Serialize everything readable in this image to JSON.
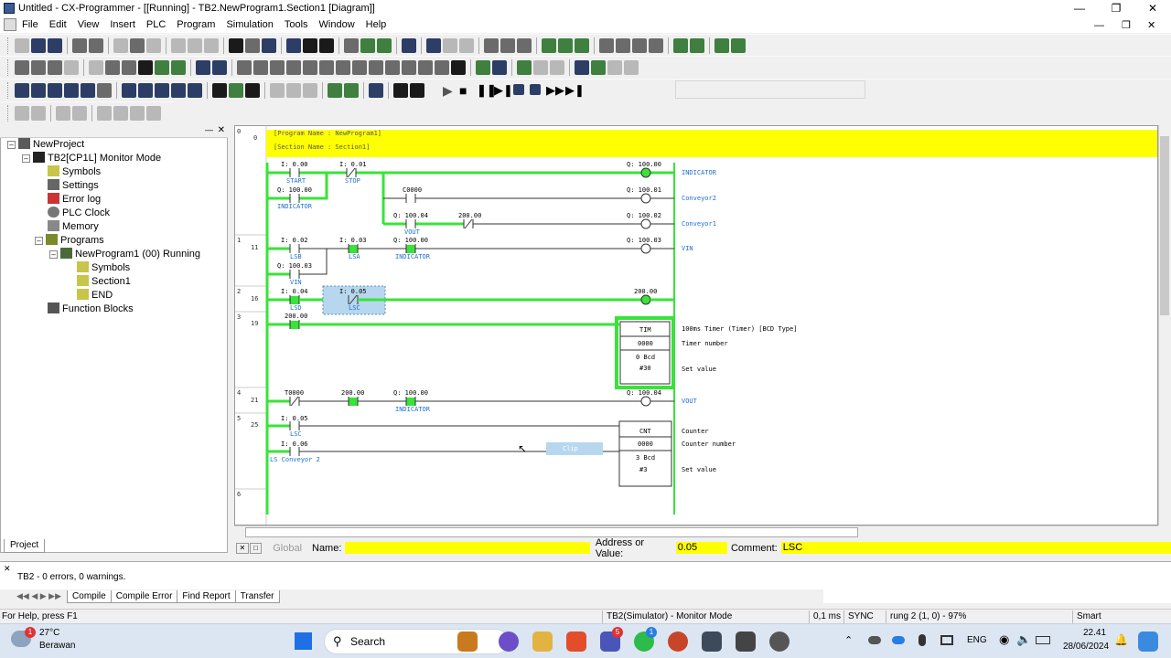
{
  "window": {
    "title": "Untitled - CX-Programmer - [[Running] - TB2.NewProgram1.Section1 [Diagram]]"
  },
  "menu": [
    "File",
    "Edit",
    "View",
    "Insert",
    "PLC",
    "Program",
    "Simulation",
    "Tools",
    "Window",
    "Help"
  ],
  "tree": {
    "root": "NewProject",
    "plc": "TB2[CP1L] Monitor Mode",
    "items": [
      "Symbols",
      "Settings",
      "Error log",
      "PLC Clock",
      "Memory"
    ],
    "programs": "Programs",
    "program": "NewProgram1 (00) Running",
    "sub": [
      "Symbols",
      "Section1",
      "END"
    ],
    "fb": "Function Blocks",
    "tab": "Project"
  },
  "diagram": {
    "header": [
      "[Program Name : NewProgram1]",
      "[Section Name : Section1]"
    ],
    "rungs": [
      {
        "idx": "0",
        "step": "0"
      },
      {
        "idx": "1",
        "step": "11"
      },
      {
        "idx": "2",
        "step": "16"
      },
      {
        "idx": "3",
        "step": "19"
      },
      {
        "idx": "4",
        "step": "21"
      },
      {
        "idx": "5",
        "step": "25"
      },
      {
        "idx": "6",
        "step": ""
      }
    ],
    "contacts": [
      {
        "addr": "I: 0.00",
        "name": "START"
      },
      {
        "addr": "I: 0.01",
        "name": "STOP"
      },
      {
        "addr": "Q: 100.00",
        "name": "INDICATOR"
      },
      {
        "addr": "C0000",
        "name": ""
      },
      {
        "addr": "Q: 100.04",
        "name": "VOUT"
      },
      {
        "addr": "200.00",
        "name": ""
      },
      {
        "addr": "I: 0.02",
        "name": "LSB"
      },
      {
        "addr": "I: 0.03",
        "name": "LSA"
      },
      {
        "addr": "Q: 100.00",
        "name": "INDICATOR"
      },
      {
        "addr": "Q: 100.03",
        "name": "VIN"
      },
      {
        "addr": "I: 0.04",
        "name": "LSD"
      },
      {
        "addr": "I: 0.05",
        "name": "LSC"
      },
      {
        "addr": "200.00",
        "name": ""
      },
      {
        "addr": "T0000",
        "name": ""
      },
      {
        "addr": "200.00",
        "name": ""
      },
      {
        "addr": "Q: 100.00",
        "name": "INDICATOR"
      },
      {
        "addr": "I: 0.05",
        "name": "LSC"
      },
      {
        "addr": "I: 0.06",
        "name": "LS Conveyor 2"
      }
    ],
    "coils": [
      {
        "addr": "Q: 100.00",
        "name": "INDICATOR"
      },
      {
        "addr": "Q: 100.01",
        "name": "Conveyor2"
      },
      {
        "addr": "Q: 100.02",
        "name": "Conveyor1"
      },
      {
        "addr": "Q: 100.03",
        "name": "VIN"
      },
      {
        "addr": "200.00",
        "name": ""
      },
      {
        "addr": "Q: 100.04",
        "name": "VOUT"
      }
    ],
    "tim": {
      "name": "TIM",
      "num": "0000",
      "val": "0 Bcd",
      "set": "#30",
      "desc": "100ms Timer (Timer) [BCD Type]",
      "l1": "Timer number",
      "l2": "Set value"
    },
    "cnt": {
      "name": "CNT",
      "num": "0000",
      "val": "3 Bcd",
      "set": "#3",
      "l1": "Counter",
      "l2": "Counter number",
      "l3": "Set value"
    },
    "clip": "Clip"
  },
  "namebar": {
    "global": "Global",
    "name_label": "Name:",
    "name_value": "",
    "addr_label": "Address or Value:",
    "addr_value": "0.05",
    "comment_label": "Comment:",
    "comment_value": "LSC"
  },
  "output": {
    "text": "TB2 - 0 errors, 0 warnings.",
    "tabs": [
      "Compile",
      "Compile Error",
      "Find Report",
      "Transfer"
    ]
  },
  "status": {
    "help": "For Help, press F1",
    "mode": "TB2(Simulator) - Monitor Mode",
    "cycle": "0,1 ms",
    "sync": "SYNC",
    "rung": "rung 2 (1, 0)  - 97%",
    "smart": "Smart"
  },
  "taskbar": {
    "temp": "27°C",
    "weather": "Berawan",
    "search": "Search",
    "lang": "ENG",
    "time": "22.41",
    "date": "28/06/2024",
    "badge1": "1",
    "badge2": "5",
    "badge3": "1"
  }
}
